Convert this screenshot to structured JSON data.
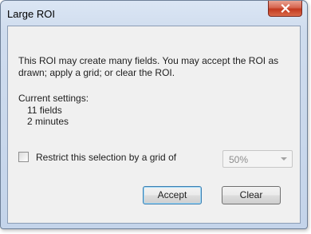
{
  "dialog": {
    "title": "Large ROI",
    "close_glyph": "✕",
    "message": "This ROI may create many fields. You may accept the ROI as drawn; apply a grid; or clear the ROI.",
    "settings_label": "Current settings:",
    "settings": [
      "11 fields",
      "2 minutes"
    ],
    "restrict": {
      "label": "Restrict this selection by a grid of",
      "checked": false,
      "grid_value": "50%"
    },
    "buttons": {
      "accept": "Accept",
      "clear": "Clear"
    }
  },
  "colors": {
    "frame": "#c4d4ea",
    "client": "#f0f0f0",
    "close_button": "#c2391e",
    "default_button_border": "#3c7fb1"
  },
  "icons": {
    "close": "close-icon",
    "dropdown": "chevron-down-icon"
  }
}
